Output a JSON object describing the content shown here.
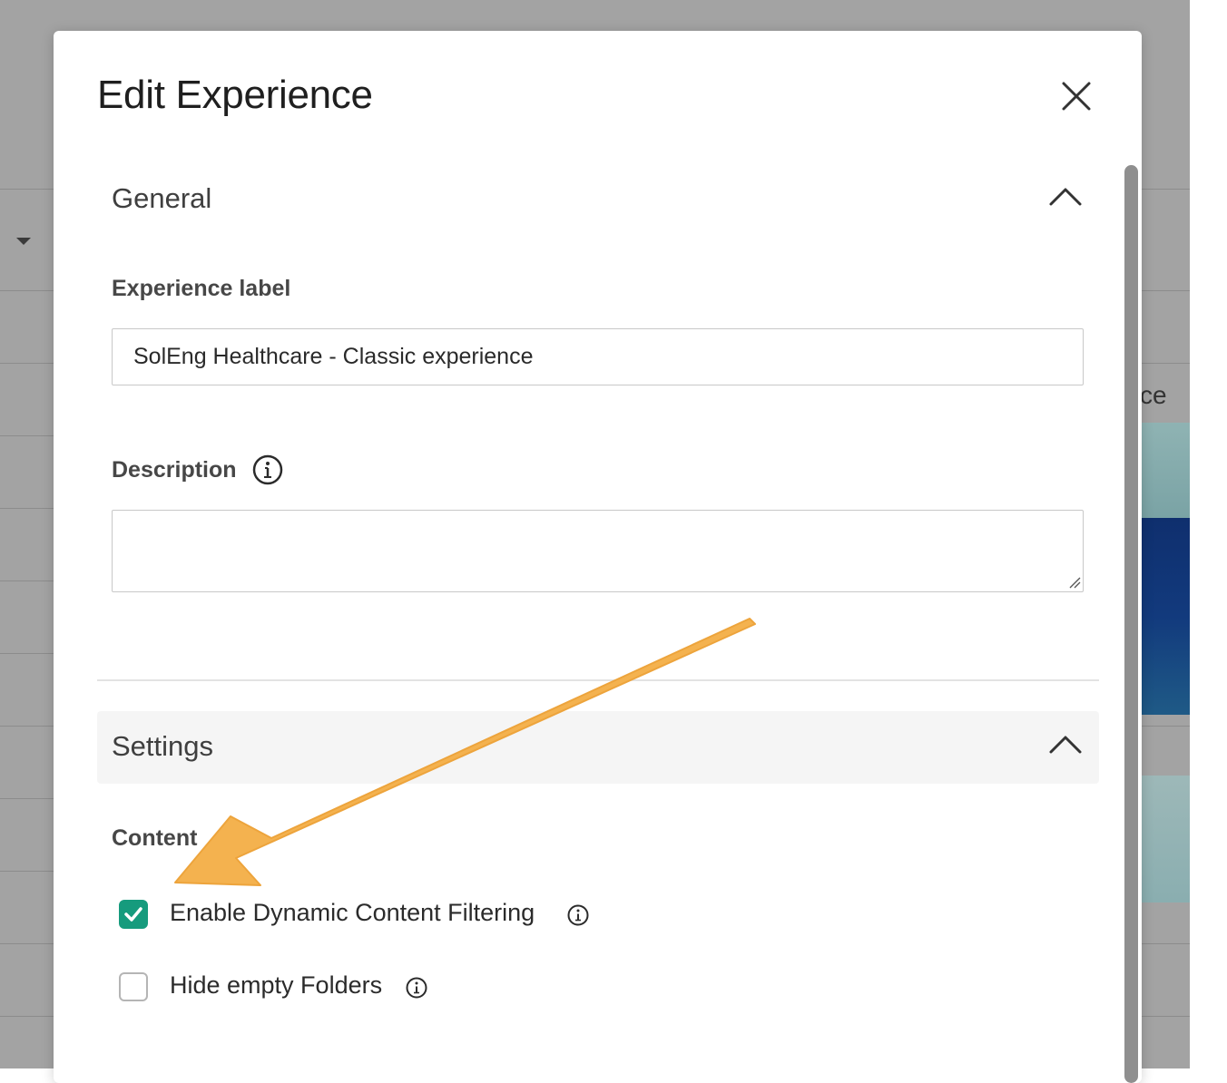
{
  "background": {
    "truncated_text": "ce"
  },
  "modal": {
    "title": "Edit Experience",
    "close_icon": "close-icon"
  },
  "general": {
    "title": "General",
    "experience_label": {
      "label": "Experience label",
      "value": "SolEng Healthcare - Classic experience"
    },
    "description": {
      "label": "Description",
      "value": ""
    }
  },
  "settings": {
    "title": "Settings",
    "content": {
      "label": "Content",
      "options": [
        {
          "label": "Enable Dynamic Content Filtering",
          "checked": true
        },
        {
          "label": "Hide empty Folders",
          "checked": false
        }
      ]
    }
  },
  "colors": {
    "accent": "#169b7d",
    "annotation_arrow": "#f4b24f"
  }
}
